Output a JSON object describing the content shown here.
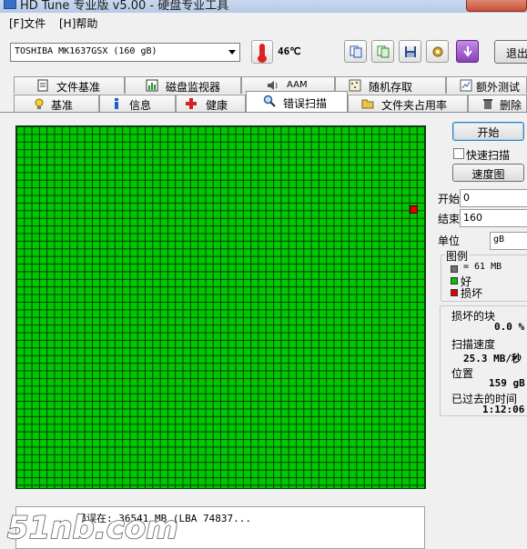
{
  "window": {
    "title": "HD Tune 专业版 v5.00 - 硬盘专业工具"
  },
  "menu": {
    "file": "[F]文件",
    "help": "[H]帮助"
  },
  "toolbar": {
    "drive": "TOSHIBA MK1637GSX (160 gB)",
    "temperature": "46℃",
    "exit_label": "退出"
  },
  "tabs": {
    "row1": [
      "文件基准",
      "磁盘监视器",
      "AAM",
      "随机存取",
      "额外测试"
    ],
    "row2": [
      "基准",
      "信息",
      "健康",
      "错误扫描",
      "文件夹占用率",
      "删除"
    ],
    "active": "错误扫描"
  },
  "scan": {
    "start_label": "开始",
    "quick_scan_label": "快速扫描",
    "speed_map_label": "速度图",
    "start_field_label": "开始",
    "start_value": "0",
    "end_field_label": "结束",
    "end_value": "160",
    "unit_label": "单位",
    "unit_value": "gB",
    "legend_title": "图例",
    "legend_block": "= 61 MB",
    "legend_good": "好",
    "legend_bad": "损坏",
    "damaged_label": "损坏的块",
    "damaged_value": "0.0 %",
    "speed_label": "扫描速度",
    "speed_value": "25.3 MB/秒",
    "position_label": "位置",
    "position_value": "159 gB",
    "elapsed_label": "已过去的时间",
    "elapsed_value": "1:12:06",
    "log_line": "错误在:  36541 MB  (LBA 74837..."
  },
  "colors": {
    "good": "#00c800",
    "bad": "#e00000",
    "block": "#707070"
  },
  "watermark": "51nb.com"
}
